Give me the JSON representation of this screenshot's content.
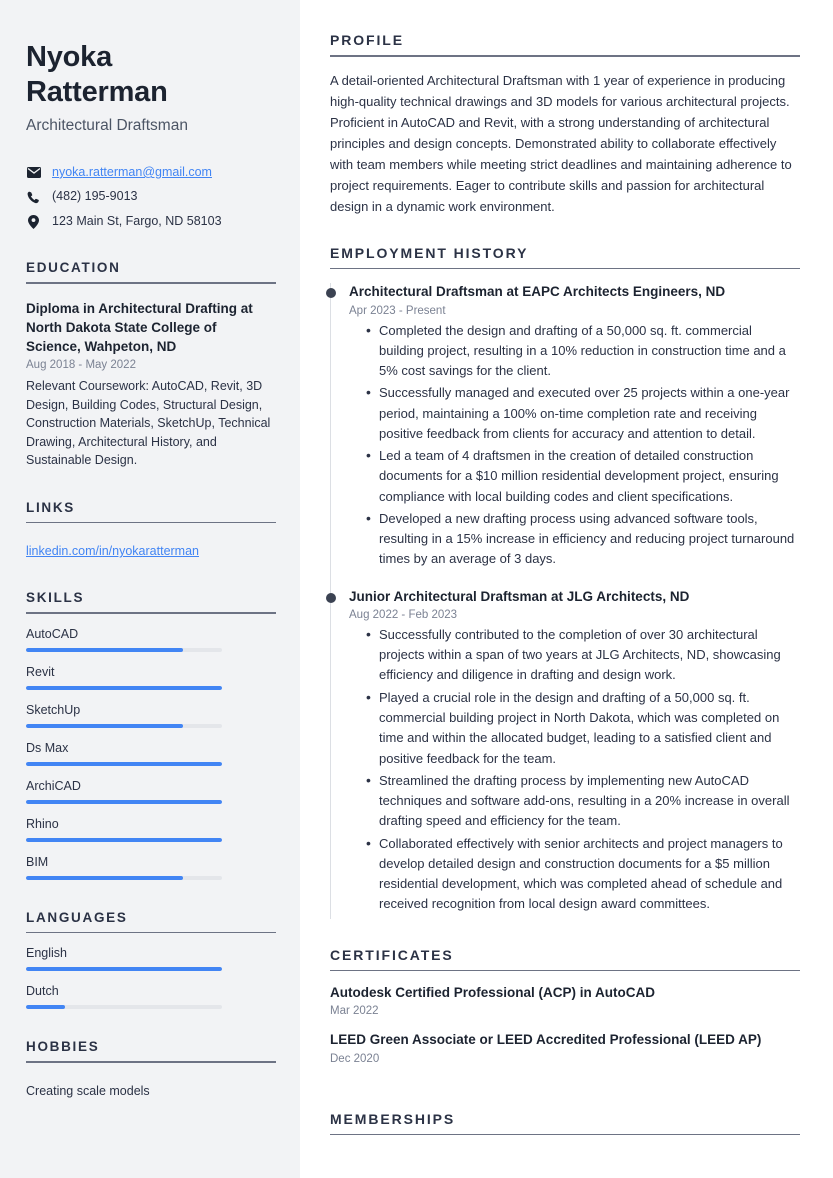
{
  "sidebar": {
    "name_line1": "Nyoka",
    "name_line2": "Ratterman",
    "job_title": "Architectural Draftsman",
    "contact": {
      "email": "nyoka.ratterman@gmail.com",
      "phone": "(482) 195-9013",
      "address": "123 Main St, Fargo, ND 58103"
    },
    "education": {
      "heading": "EDUCATION",
      "entries": [
        {
          "title": "Diploma in Architectural Drafting at North Dakota State College of Science, Wahpeton, ND",
          "date": "Aug 2018 - May 2022",
          "description": "Relevant Coursework: AutoCAD, Revit, 3D Design, Building Codes, Structural Design, Construction Materials, SketchUp, Technical Drawing, Architectural History, and Sustainable Design."
        }
      ]
    },
    "links": {
      "heading": "LINKS",
      "items": [
        {
          "label": "linkedin.com/in/nyokaratterman"
        }
      ]
    },
    "skills": {
      "heading": "SKILLS",
      "items": [
        {
          "label": "AutoCAD",
          "level": 80
        },
        {
          "label": "Revit",
          "level": 100
        },
        {
          "label": "SketchUp",
          "level": 80
        },
        {
          "label": "Ds Max",
          "level": 100
        },
        {
          "label": "ArchiCAD",
          "level": 100
        },
        {
          "label": "Rhino",
          "level": 100
        },
        {
          "label": "BIM",
          "level": 80
        }
      ]
    },
    "languages": {
      "heading": "LANGUAGES",
      "items": [
        {
          "label": "English",
          "level": 100
        },
        {
          "label": "Dutch",
          "level": 20
        }
      ]
    },
    "hobbies": {
      "heading": "HOBBIES",
      "text": "Creating scale models"
    }
  },
  "main": {
    "profile": {
      "heading": "PROFILE",
      "text": "A detail-oriented Architectural Draftsman with 1 year of experience in producing high-quality technical drawings and 3D models for various architectural projects. Proficient in AutoCAD and Revit, with a strong understanding of architectural principles and design concepts. Demonstrated ability to collaborate effectively with team members while meeting strict deadlines and maintaining adherence to project requirements. Eager to contribute skills and passion for architectural design in a dynamic work environment."
    },
    "employment": {
      "heading": "EMPLOYMENT HISTORY",
      "jobs": [
        {
          "title": "Architectural Draftsman at EAPC Architects Engineers, ND",
          "date": "Apr 2023 - Present",
          "bullets": [
            "Completed the design and drafting of a 50,000 sq. ft. commercial building project, resulting in a 10% reduction in construction time and a 5% cost savings for the client.",
            "Successfully managed and executed over 25 projects within a one-year period, maintaining a 100% on-time completion rate and receiving positive feedback from clients for accuracy and attention to detail.",
            "Led a team of 4 draftsmen in the creation of detailed construction documents for a $10 million residential development project, ensuring compliance with local building codes and client specifications.",
            "Developed a new drafting process using advanced software tools, resulting in a 15% increase in efficiency and reducing project turnaround times by an average of 3 days."
          ]
        },
        {
          "title": "Junior Architectural Draftsman at JLG Architects, ND",
          "date": "Aug 2022 - Feb 2023",
          "bullets": [
            "Successfully contributed to the completion of over 30 architectural projects within a span of two years at JLG Architects, ND, showcasing efficiency and diligence in drafting and design work.",
            "Played a crucial role in the design and drafting of a 50,000 sq. ft. commercial building project in North Dakota, which was completed on time and within the allocated budget, leading to a satisfied client and positive feedback for the team.",
            "Streamlined the drafting process by implementing new AutoCAD techniques and software add-ons, resulting in a 20% increase in overall drafting speed and efficiency for the team.",
            "Collaborated effectively with senior architects and project managers to develop detailed design and construction documents for a $5 million residential development, which was completed ahead of schedule and received recognition from local design award committees."
          ]
        }
      ]
    },
    "certificates": {
      "heading": "CERTIFICATES",
      "items": [
        {
          "title": "Autodesk Certified Professional (ACP) in AutoCAD",
          "date": "Mar 2022"
        },
        {
          "title": "LEED Green Associate or LEED Accredited Professional (LEED AP)",
          "date": "Dec 2020"
        }
      ]
    },
    "memberships": {
      "heading": "MEMBERSHIPS"
    }
  },
  "colors": {
    "accent": "#4285f4",
    "sidebar_bg": "#f2f3f5",
    "heading": "#2b3245",
    "muted": "#7b8293"
  }
}
